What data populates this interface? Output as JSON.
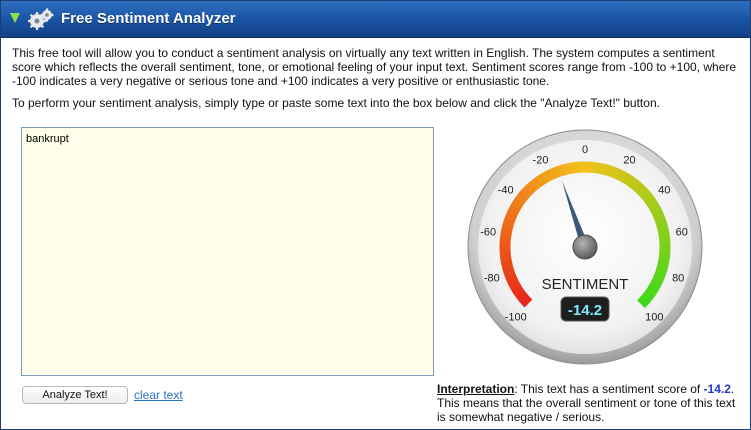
{
  "window": {
    "title": "Free Sentiment Analyzer"
  },
  "intro": {
    "paragraph1": "This free tool will allow you to conduct a sentiment analysis on virtually any text written in English. The system computes a sentiment score which reflects the overall sentiment, tone, or emotional feeling of your input text. Sentiment scores range from -100 to +100, where -100 indicates a very negative or serious tone and +100 indicates a very positive or enthusiastic tone.",
    "paragraph2": "To perform your sentiment analysis, simply type or paste some text into the box below and click the \"Analyze Text!\" button."
  },
  "input": {
    "value": "bankrupt"
  },
  "actions": {
    "analyze_label": "Analyze Text!",
    "clear_label": "clear text"
  },
  "gauge": {
    "label": "SENTIMENT",
    "value": -14.2,
    "value_text": "-14.2",
    "min": -100,
    "max": 100,
    "tick_labels": [
      "-100",
      "-80",
      "-60",
      "-40",
      "-20",
      "0",
      "20",
      "40",
      "60",
      "80",
      "100"
    ],
    "colors": {
      "negative": "#e8231a",
      "neutral": "#f2c21b",
      "positive": "#3dd81b",
      "needle": "#3c5a78",
      "readout_text": "#7fe8ff"
    }
  },
  "interpretation": {
    "label": "Interpretation",
    "text_before": ": This text has a sentiment score of ",
    "score": "-14.2",
    "text_after": ". This means that the overall sentiment or tone of this text is somewhat negative / serious."
  }
}
